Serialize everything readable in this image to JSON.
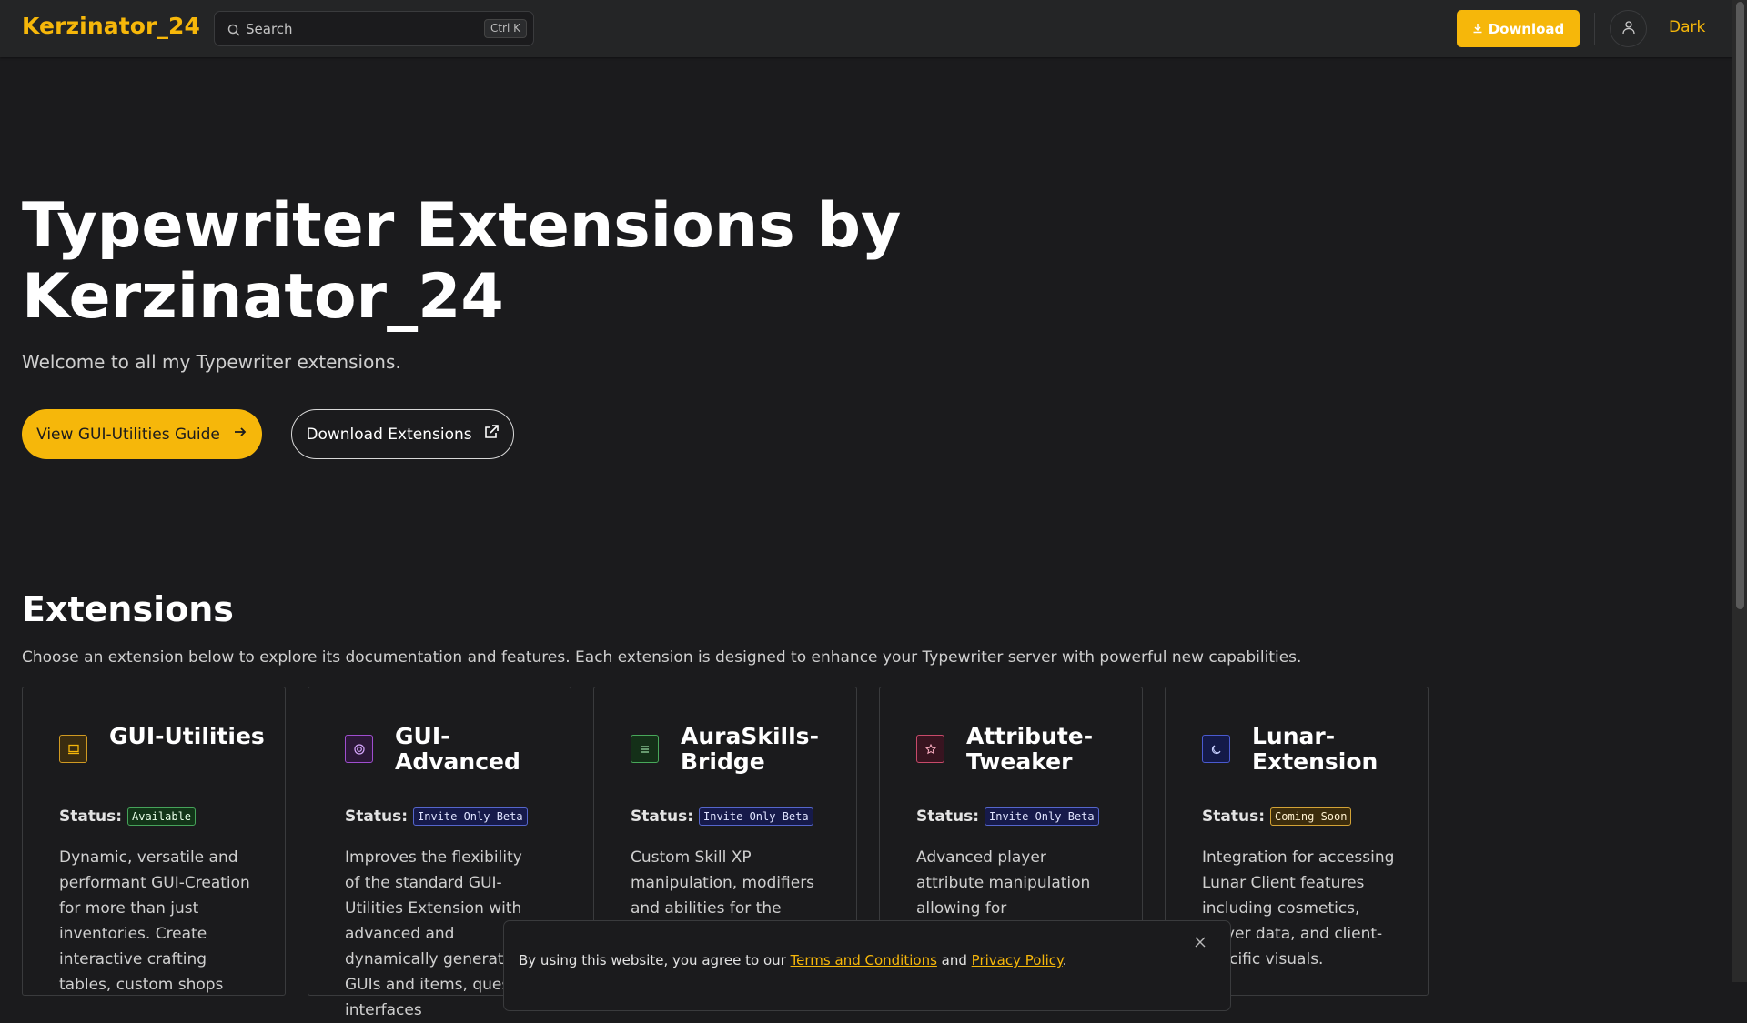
{
  "navbar": {
    "brand": "Kerzinator_24",
    "search_placeholder": "Search",
    "search_shortcut": "Ctrl K",
    "download_label": "Download",
    "theme_label": "Dark"
  },
  "hero": {
    "title": "Typewriter Extensions by Kerzinator_24",
    "subtitle": "Welcome to all my Typewriter extensions.",
    "primary_button": "View GUI-Utilities Guide",
    "secondary_button": "Download Extensions"
  },
  "extensions": {
    "title": "Extensions",
    "description": "Choose an extension below to explore its documentation and features. Each extension is designed to enhance your Typewriter server with powerful new capabilities.",
    "status_label": "Status:",
    "cards": [
      {
        "title": "GUI-Utilities",
        "status": "Available",
        "icon": "window-icon",
        "description": "Dynamic, versatile and performant GUI-Creation for more than just inventories. Create interactive crafting tables, custom shops"
      },
      {
        "title": "GUI-Advanced",
        "status": "Invite-Only Beta",
        "icon": "target-icon",
        "description": "Improves the flexibility of the standard GUI-Utilities Extension with advanced and dynamically generated GUIs and items, quest interfaces"
      },
      {
        "title": "AuraSkills-Bridge",
        "status": "Invite-Only Beta",
        "icon": "list-icon",
        "description": "Custom Skill XP manipulation, modifiers and abilities for the"
      },
      {
        "title": "Attribute-Tweaker",
        "status": "Invite-Only Beta",
        "icon": "star-icon",
        "description": "Advanced player attribute manipulation allowing for sophisticated"
      },
      {
        "title": "Lunar-Extension",
        "status": "Coming Soon",
        "icon": "moon-icon",
        "description": "Integration for accessing Lunar Client features including cosmetics, player data, and client-specific visuals."
      }
    ]
  },
  "cookie_banner": {
    "text_before": "By using this website, you agree to our ",
    "terms_link": "Terms and Conditions",
    "text_middle": " and ",
    "privacy_link": "Privacy Policy",
    "text_after": "."
  },
  "colors": {
    "accent": "#f6b70a",
    "background": "#1b1b1d",
    "navbar": "#242526"
  }
}
